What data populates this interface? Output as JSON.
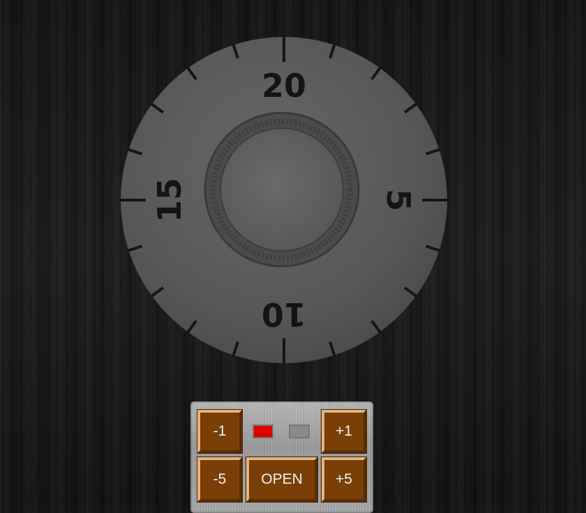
{
  "dial": {
    "labels": [
      {
        "text": "20",
        "value": 0
      },
      {
        "text": "5",
        "value": 5
      },
      {
        "text": "10",
        "value": 10
      },
      {
        "text": "15",
        "value": 15
      }
    ],
    "positions": 20
  },
  "controls": {
    "minus1": "-1",
    "plus1": "+1",
    "minus5": "-5",
    "open": "OPEN",
    "plus5": "+5"
  },
  "indicators": {
    "left_color": "#e00000",
    "right_color": "#8a8a8a"
  },
  "colors": {
    "button_face": "#7a3f06",
    "dial_face": "#5b5b5b"
  }
}
